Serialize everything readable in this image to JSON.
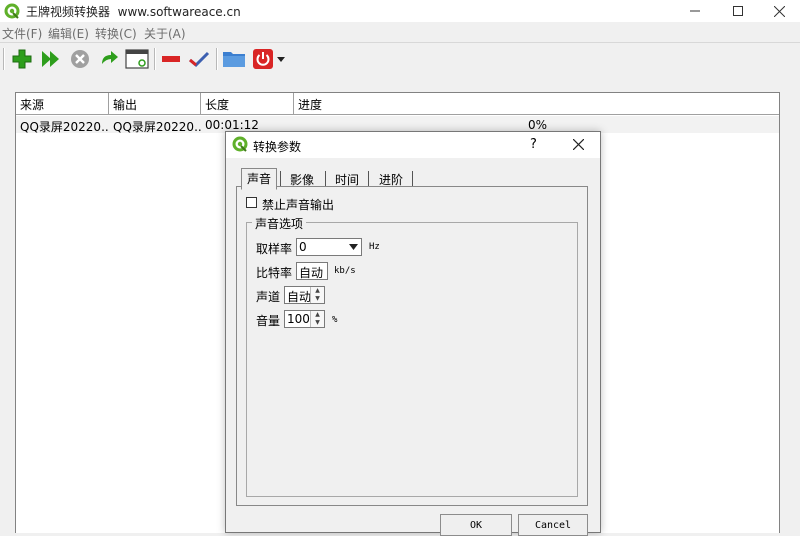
{
  "app": {
    "title": "王牌视频转换器",
    "website": "www.softwareace.cn"
  },
  "menu": {
    "items": [
      {
        "label": "文件(F)"
      },
      {
        "label": "编辑(E)"
      },
      {
        "label": "转换(C)"
      },
      {
        "label": "关于(A)"
      }
    ]
  },
  "toolbar": {
    "icons": [
      "add-icon",
      "start-icon",
      "stop-icon",
      "redo-icon",
      "window-icon",
      "remove-icon",
      "check-icon",
      "folder-icon",
      "power-icon",
      "dropdown-icon"
    ],
    "colors": {
      "green": "#2e9e1c",
      "red": "#d92525",
      "blue": "#3c7fd0",
      "gray": "#a0a0a0"
    }
  },
  "list": {
    "columns": [
      "来源",
      "输出",
      "长度",
      "进度"
    ],
    "rows": [
      {
        "source": "QQ录屏20220...",
        "output": "QQ录屏20220...",
        "duration": "00:01:12",
        "progress": "0%"
      }
    ]
  },
  "dialog": {
    "title": "转换参数",
    "help": "?",
    "tabs": [
      "声音",
      "影像",
      "时间",
      "进阶"
    ],
    "mute_label": "禁止声音输出",
    "group_label": "声音选项",
    "sample_rate": {
      "label": "取样率",
      "value": "0",
      "unit": "Hz"
    },
    "bitrate": {
      "label": "比特率",
      "value": "自动",
      "unit": "kb/s"
    },
    "channel": {
      "label": "声道",
      "value": "自动"
    },
    "volume": {
      "label": "音量",
      "value": "100",
      "unit": "%"
    },
    "ok_label": "OK",
    "cancel_label": "Cancel"
  }
}
